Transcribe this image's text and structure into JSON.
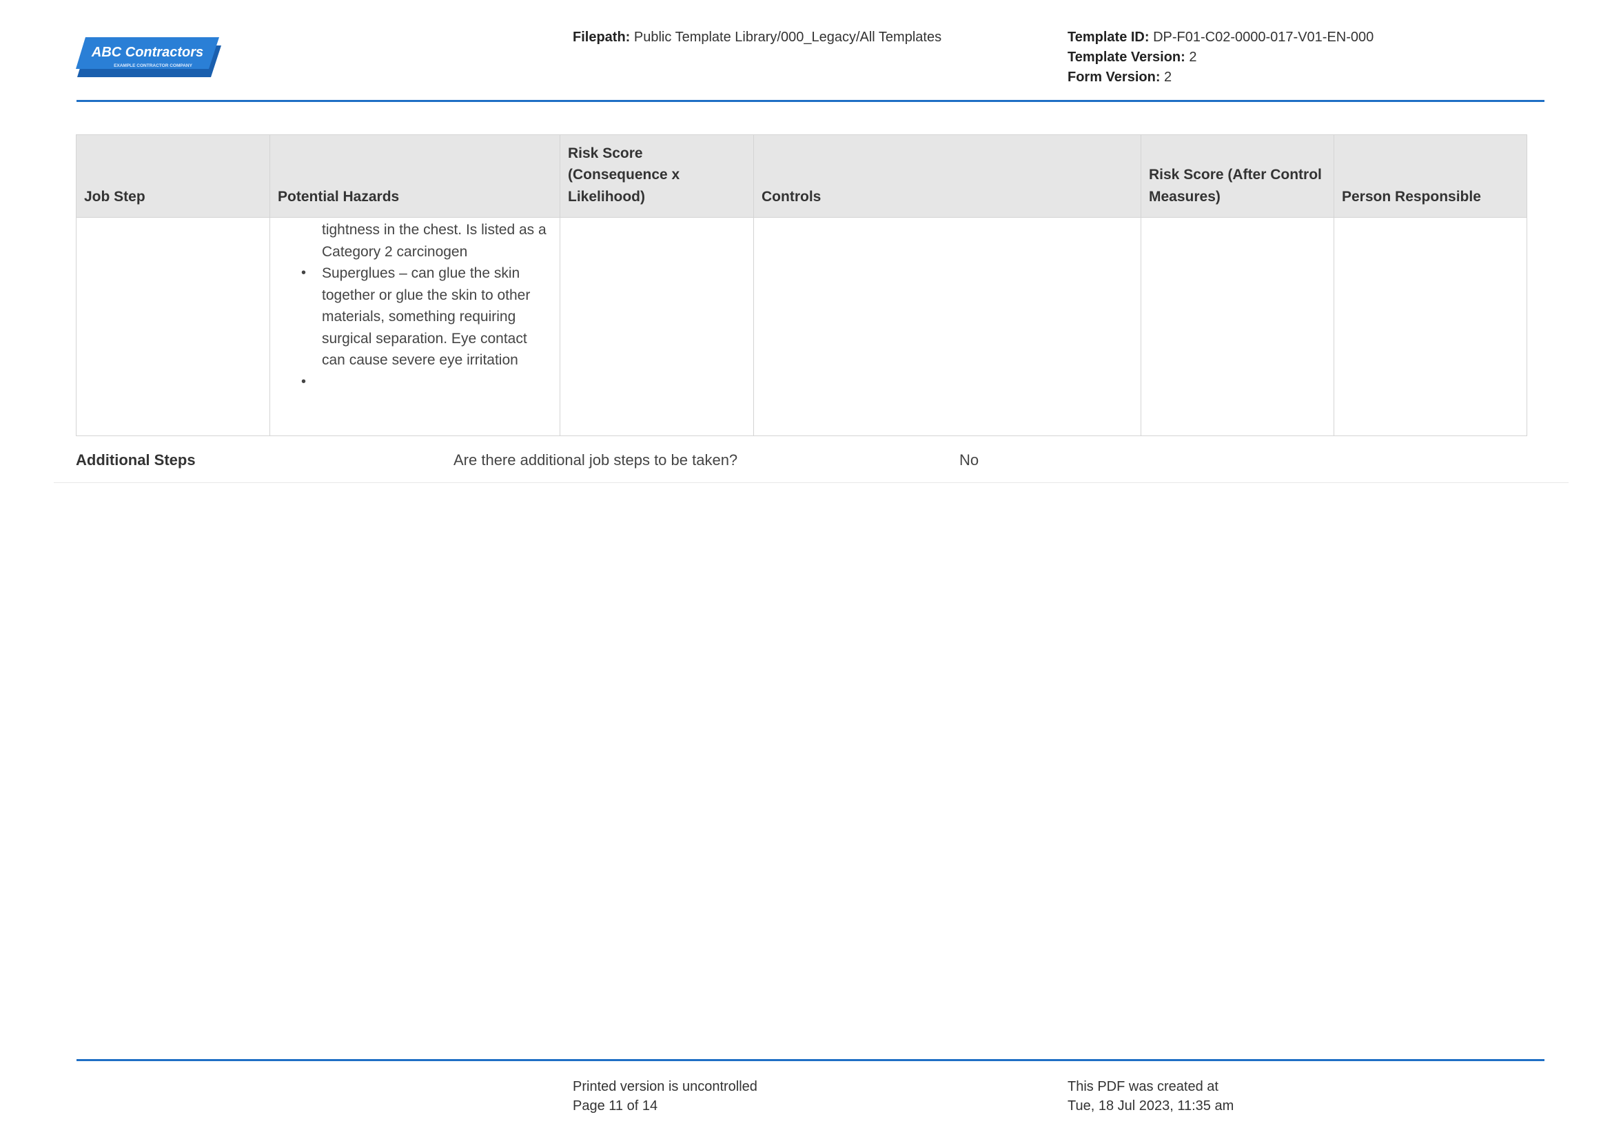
{
  "header": {
    "logo": {
      "name": "ABC Contractors",
      "tagline": "EXAMPLE CONTRACTOR COMPANY",
      "color": "#2a7fd6"
    },
    "filepath_label": "Filepath:",
    "filepath_value": "Public Template Library/000_Legacy/All Templates",
    "template_id_label": "Template ID:",
    "template_id_value": "DP-F01-C02-0000-017-V01-EN-000",
    "template_version_label": "Template Version:",
    "template_version_value": "2",
    "form_version_label": "Form Version:",
    "form_version_value": "2"
  },
  "table": {
    "columns": [
      "Job Step",
      "Potential Hazards",
      "Risk Score (Consequence x Likelihood)",
      "Controls",
      "Risk Score (After Control Measures)",
      "Person Responsible"
    ],
    "row": {
      "job_step": "",
      "hazards_continued": "tightness in the chest. Is listed as a Category 2 carcinogen",
      "hazards_items": [
        "Superglues – can glue the skin together or glue the skin to other materials, something requiring surgical separation. Eye contact can cause severe eye irritation",
        ""
      ],
      "risk_score": "",
      "controls": "",
      "risk_score_after": "",
      "person_responsible": ""
    }
  },
  "additional_steps": {
    "label": "Additional Steps",
    "question": "Are there additional job steps to be taken?",
    "answer": "No"
  },
  "footer": {
    "uncontrolled": "Printed version is uncontrolled",
    "page": "Page 11 of 14",
    "created_label": "This PDF was created at",
    "created_date": "Tue, 18 Jul 2023, 11:35 am"
  },
  "colors": {
    "accent": "#1f6fc5",
    "table_header_bg": "#e6e6e6",
    "border": "#d4d4d4"
  }
}
